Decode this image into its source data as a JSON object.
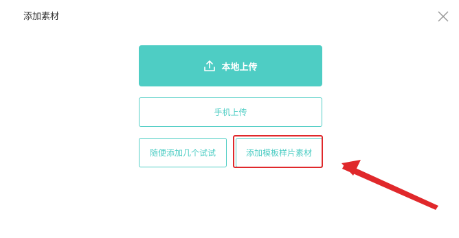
{
  "dialog": {
    "title": "添加素材",
    "close_icon": "close-icon"
  },
  "buttons": {
    "local_upload": "本地上传",
    "local_upload_icon": "upload-icon",
    "mobile_upload": "手机上传",
    "random_add": "随便添加几个试试",
    "add_template": "添加模板样片素材"
  },
  "annotation": {
    "highlight_color": "#e0282b",
    "arrow_color": "#e0282b"
  },
  "colors": {
    "accent": "#4ecdc4",
    "title_text": "#333333",
    "close_icon": "#999999"
  }
}
